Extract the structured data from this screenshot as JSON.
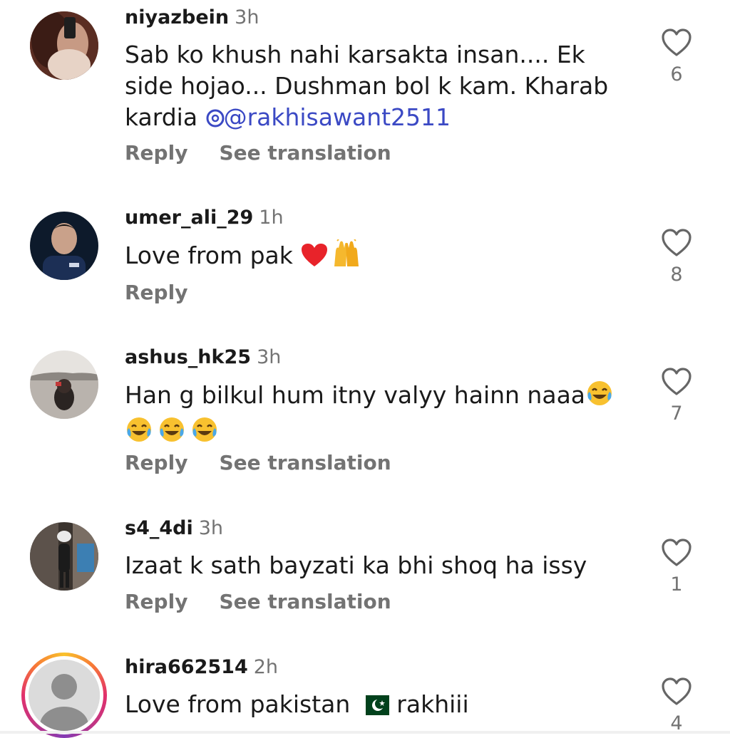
{
  "comments": [
    {
      "username": "niyazbein",
      "time": "3h",
      "text_line1": "Sab ko khush nahi karsakta insan.... Ek",
      "text_line2": "side hojao... Dushman bol k kam. Kharab",
      "text_line3_prefix": "kardia ",
      "mention": "@rakhisawant2511",
      "reply_label": "Reply",
      "translate_label": "See translation",
      "likes": "6"
    },
    {
      "username": "umer_ali_29",
      "time": "1h",
      "text": "Love from pak ",
      "reply_label": "Reply",
      "likes": "8"
    },
    {
      "username": "ashus_hk25",
      "time": "3h",
      "text": "Han g bilkul hum itny valyy hainn naaa",
      "reply_label": "Reply",
      "translate_label": "See translation",
      "likes": "7"
    },
    {
      "username": "s4_4di",
      "time": "3h",
      "text": "Izaat k sath bayzati ka bhi shoq ha issy",
      "reply_label": "Reply",
      "translate_label": "See translation",
      "likes": "1"
    },
    {
      "username": "hira662514",
      "time": "2h",
      "text_prefix": "Love from pakistan ",
      "text_suffix": " rakhiii",
      "likes": "4"
    }
  ],
  "icons": {
    "like": "heart-outline-icon",
    "mention_prefix": "threads-icon",
    "emoji_heart": "red-heart-emoji",
    "emoji_hands": "raising-hands-emoji",
    "emoji_laugh": "tears-of-joy-emoji",
    "flag": "pakistan-flag-emoji"
  },
  "colors": {
    "text": "#1a1a1a",
    "muted": "#737373",
    "mention": "#3b49c4",
    "ring_start": "#f9c22b",
    "ring_end": "#833ab4"
  }
}
